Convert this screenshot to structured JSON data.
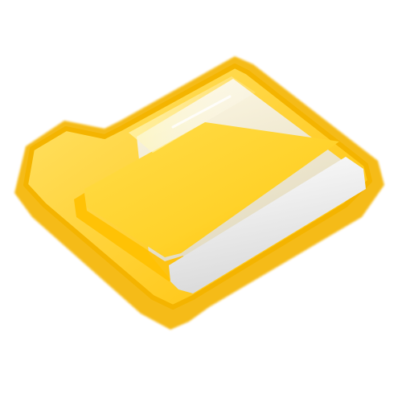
{
  "image": {
    "subject": "folder-icon",
    "background_color": "#ffffff"
  },
  "colors": {
    "outline": "#f4b400",
    "outline_dark": "#e6a100",
    "body_light": "#ffe36b",
    "body_mid": "#ffd22a",
    "body_dark": "#ffc000",
    "paper_light": "#ffffff",
    "paper_shade": "#d9d9d9",
    "glow": "#fff7b8"
  }
}
